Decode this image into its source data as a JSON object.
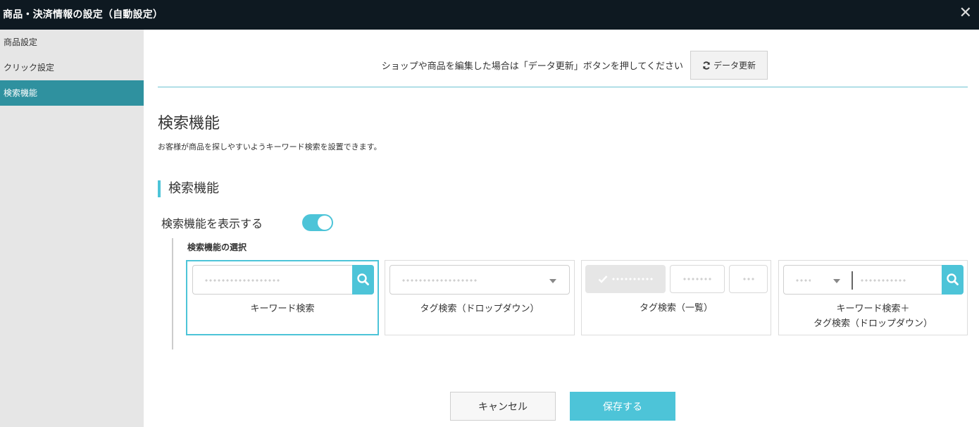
{
  "window": {
    "title": "商品・決済情報の設定（自動設定）",
    "close_glyph": "✕"
  },
  "sidebar": {
    "items": [
      {
        "label": "商品設定",
        "active": false
      },
      {
        "label": "クリック設定",
        "active": false
      },
      {
        "label": "検索機能",
        "active": true
      }
    ]
  },
  "notice": {
    "message": "ショップや商品を編集した場合は「データ更新」ボタンを押してください",
    "refresh_label": "データ更新",
    "refresh_icon": "refresh-icon"
  },
  "page": {
    "title": "検索機能",
    "description": "お客様が商品を探しやすいようキーワード検索を設置できます。"
  },
  "section": {
    "title": "検索機能",
    "toggle_label": "検索機能を表示する",
    "toggle_on": true,
    "options_title": "検索機能の選択",
    "options": [
      {
        "label": "キーワード検索",
        "selected": true
      },
      {
        "label": "タグ検索（ドロップダウン）",
        "selected": false
      },
      {
        "label": "タグ検索（一覧）",
        "selected": false
      },
      {
        "label_line1": "キーワード検索＋",
        "label_line2": "タグ検索（ドロップダウン）",
        "selected": false
      }
    ]
  },
  "footer": {
    "cancel_label": "キャンセル",
    "save_label": "保存する"
  },
  "colors": {
    "accent": "#4dc4d8",
    "sidebar_active": "#2f919f",
    "titlebar": "#0e1921"
  }
}
